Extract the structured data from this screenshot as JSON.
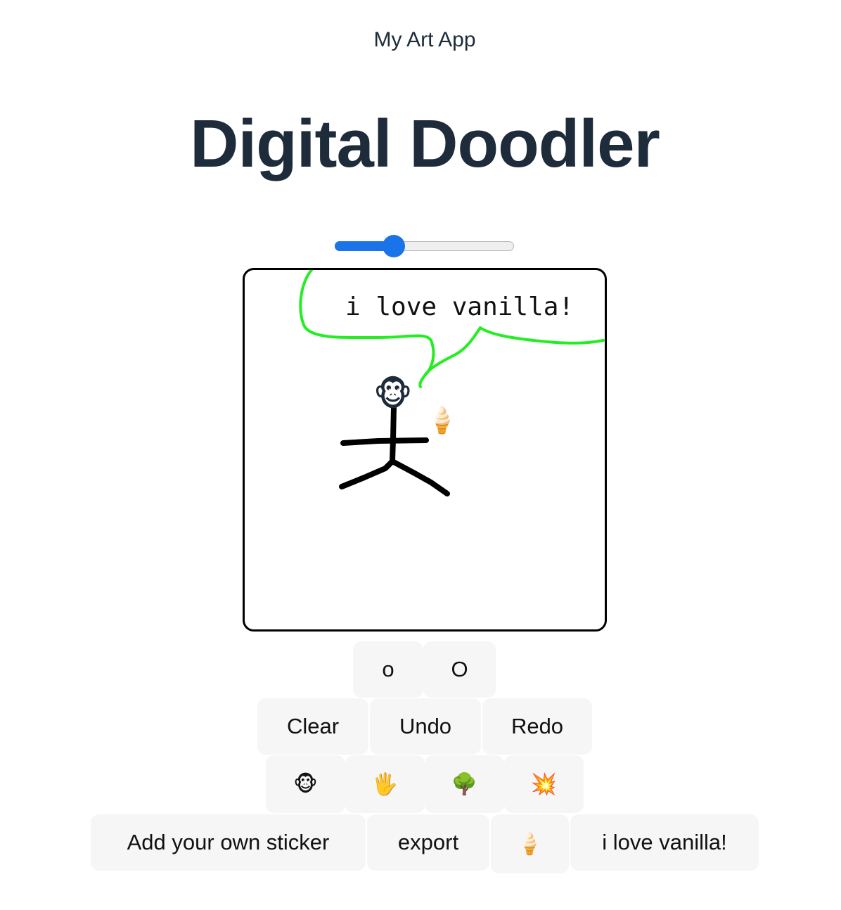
{
  "header": {
    "app_name": "My Art App",
    "title": "Digital Doodler"
  },
  "brush_size_slider": {
    "value_fraction": 0.33,
    "accent_color": "#1a73e8"
  },
  "canvas": {
    "stroke_colors": {
      "speech_bubble": "#22ee22",
      "stick_figure": "#000000"
    },
    "text_stamp": "i love vanilla!",
    "placed_stickers": [
      "monkey-face",
      "ice-cream"
    ],
    "sticker_glyphs": {
      "monkey": "🐵",
      "ice_cream": "🍦"
    }
  },
  "size_buttons": {
    "small": "o",
    "large": "O"
  },
  "history_buttons": {
    "clear": "Clear",
    "undo": "Undo",
    "redo": "Redo"
  },
  "sticker_buttons": {
    "monkey": "🐵",
    "hand": "🖐",
    "tree": "🌳",
    "collision": "💥"
  },
  "extra_buttons": {
    "add_sticker": "Add your own sticker",
    "export": "export",
    "ice_cream": "🍦",
    "custom_text": "i love vanilla!"
  }
}
